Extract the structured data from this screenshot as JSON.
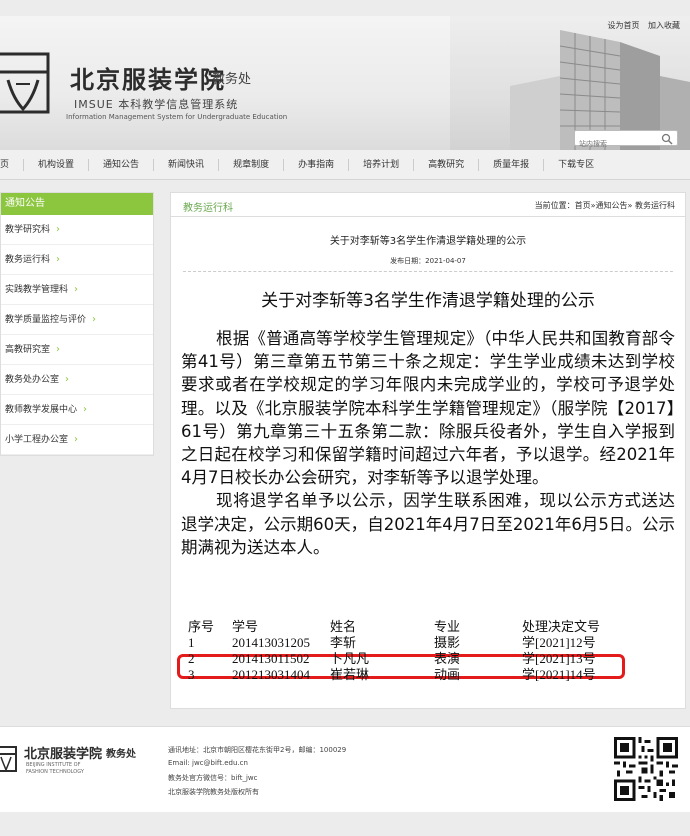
{
  "header": {
    "school_cn": "北京服装学院",
    "dept": "教务处",
    "imsue": "IMSUE  本科教学信息管理系统",
    "system_en": "Information Management System for Undergraduate Education",
    "top_links": [
      "设为首页",
      "加入收藏"
    ],
    "search_placeholder": "站内搜索"
  },
  "nav": {
    "items": [
      "页",
      "机构设置",
      "通知公告",
      "新闻快讯",
      "规章制度",
      "办事指南",
      "培养计划",
      "高教研究",
      "质量年报",
      "下载专区"
    ]
  },
  "sidebar": {
    "heading": "通知公告",
    "items": [
      "教学研究科",
      "教务运行科",
      "实践教学管理科",
      "教学质量监控与评价",
      "高教研究室",
      "教务处办公室",
      "教师教学发展中心",
      "小学工程办公室"
    ],
    "arrow": "›"
  },
  "main": {
    "section": "教务运行科",
    "breadcrumb": "当前位置：首页»通知公告» 教务运行科",
    "title": "关于对李斩等3名学生作清退学籍处理的公示",
    "date": "发布日期：2021-04-07",
    "body_title": "关于对李斩等3名学生作清退学籍处理的公示",
    "para1": "根据《普通高等学校学生管理规定》（中华人民共和国教育部令第41号）第三章第五节第三十条之规定：学生学业成绩未达到学校要求或者在学校规定的学习年限内未完成学业的，学校可予退学处理。以及《北京服装学院本科学生学籍管理规定》（服学院【2017】61号）第九章第三十五条第二款：除服兵役者外，学生自入学报到之日起在校学习和保留学籍时间超过六年者，予以退学。经2021年4月7日校长办公会研究，对李斩等予以退学处理。",
    "para2": "现将退学名单予以公示，因学生联系困难，现以公示方式送达退学决定，公示期60天，自2021年4月7日至2021年6月5日。公示期满视为送达本人。",
    "table": {
      "headers": [
        "序号",
        "学号",
        "姓名",
        "专业",
        "处理决定文号"
      ],
      "rows": [
        [
          "1",
          "201413031205",
          "李斩",
          "摄影",
          "学[2021]12号"
        ],
        [
          "2",
          "201413011502",
          "卜凡凡",
          "表演",
          "学[2021]13号"
        ],
        [
          "3",
          "201213031404",
          "崔若琳",
          "动画",
          "学[2021]14号"
        ]
      ]
    },
    "highlight_color": "#e31b1b"
  },
  "footer": {
    "school_cn": "北京服装学院",
    "dept": "教务处",
    "en1": "BEIJING INSTITUTE OF",
    "en2": "FASHION TECHNOLOGY",
    "address": "通讯地址：北京市朝阳区樱花东街甲2号，邮编：100029",
    "email": "Email: jwc@bift.edu.cn",
    "wechat": "教务处官方微信号：bift_jwc",
    "copyright": "北京服装学院教务处版权所有"
  },
  "colors": {
    "accent_green": "#8cc63f",
    "section_green": "#6aa84f"
  }
}
